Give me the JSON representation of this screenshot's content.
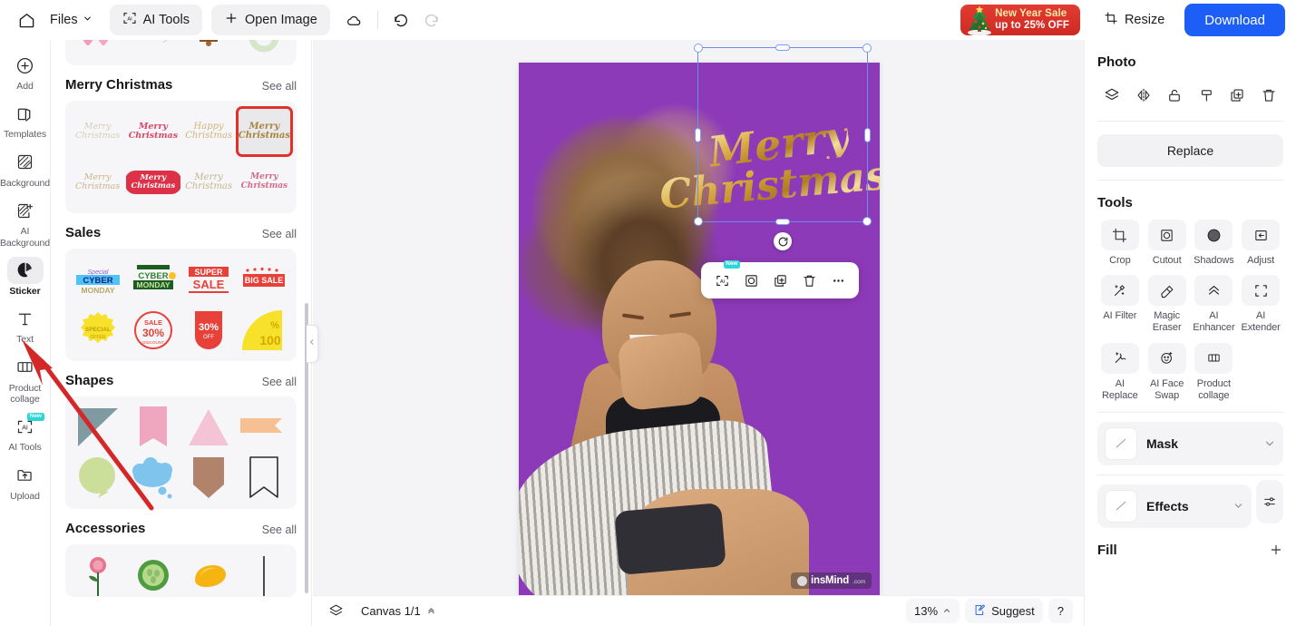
{
  "topbar": {
    "home_icon": "home-icon",
    "files_label": "Files",
    "files_chevron": "chevron-down-icon",
    "ai_tools_label": "AI Tools",
    "open_image_label": "Open Image",
    "cloud_icon": "cloud-sync-icon",
    "undo_icon": "undo-icon",
    "redo_icon": "redo-icon",
    "sale_line1": "New Year Sale",
    "sale_line2": "up to 25% OFF",
    "resize_label": "Resize",
    "download_label": "Download"
  },
  "rail": {
    "items": [
      {
        "label": "Add",
        "icon": "plus-circle-icon",
        "active": false
      },
      {
        "label": "Templates",
        "icon": "templates-icon",
        "active": false
      },
      {
        "label": "Background",
        "icon": "background-icon",
        "active": false
      },
      {
        "label": "AI Background",
        "icon": "ai-background-icon",
        "active": false
      },
      {
        "label": "Sticker",
        "icon": "sticker-icon",
        "active": true
      },
      {
        "label": "Text",
        "icon": "text-icon",
        "active": false
      },
      {
        "label": "Product collage",
        "icon": "product-collage-icon",
        "active": false
      },
      {
        "label": "AI Tools",
        "icon": "ai-tools-icon",
        "active": false,
        "badge": "New"
      },
      {
        "label": "Upload",
        "icon": "upload-icon",
        "active": false
      }
    ]
  },
  "panel": {
    "see_all_label": "See all",
    "sections": [
      {
        "title": "",
        "partial": true,
        "items": [
          {
            "kind": "xmas-hearts",
            "label": "pink hearts sticker"
          },
          {
            "kind": "xmas-text-faded",
            "label": "faded text sticker"
          },
          {
            "kind": "xmas-bells",
            "label": "christmas bells sticker"
          },
          {
            "kind": "xmas-wreath",
            "label": "green wreath sticker"
          }
        ]
      },
      {
        "title": "Merry Christmas",
        "items": [
          {
            "kind": "script-gold-pale",
            "label": "Merry Christmas pale gold script",
            "selected": false
          },
          {
            "kind": "script-red-dots",
            "label": "Merry Christmas red script",
            "selected": false
          },
          {
            "kind": "script-gold-light",
            "label": "Happy Christmas gold script",
            "selected": false
          },
          {
            "kind": "script-gold-bold",
            "label": "Merry Christmas gold script",
            "selected": true
          },
          {
            "kind": "script-gold-outline",
            "label": "Merry Christmas gold outline",
            "selected": false
          },
          {
            "kind": "script-red-badge",
            "label": "Merry Christmas red badge",
            "selected": false
          },
          {
            "kind": "script-cream-swirl",
            "label": "Merry Christmas cream swirl",
            "selected": false
          },
          {
            "kind": "script-pink-small",
            "label": "Merry Christmas pink script",
            "selected": false
          }
        ]
      },
      {
        "title": "Sales",
        "items": [
          {
            "kind": "cyber-monday-blue",
            "label": "Cyber Monday blue sticker",
            "text": "CYBER MONDAY"
          },
          {
            "kind": "cyber-monday-green",
            "label": "Cyber Monday green sticker",
            "text": "CYBER MONDAY"
          },
          {
            "kind": "super-sale",
            "label": "Super Sale sticker",
            "text": "SUPER SALE"
          },
          {
            "kind": "big-sale",
            "label": "Big Sale sticker",
            "text": "BIG SALE"
          },
          {
            "kind": "special-offer",
            "label": "Special Offer badge",
            "text": "SPECIAL OFFER"
          },
          {
            "kind": "sale-30-circle",
            "label": "Sale 30% discount circle",
            "text": "SALE 30% DISCOUNT"
          },
          {
            "kind": "30-off-tag",
            "label": "30% Off red tag",
            "text": "30% OFF"
          },
          {
            "kind": "100-percent",
            "label": "100 percent yellow badge",
            "text": "% 100"
          }
        ]
      },
      {
        "title": "Shapes",
        "items": [
          {
            "kind": "shape-triangle-grey",
            "label": "grey triangle block shape"
          },
          {
            "kind": "shape-banner-pink",
            "label": "pink ribbon banner shape"
          },
          {
            "kind": "shape-triangle-pink",
            "label": "pink triangle shape"
          },
          {
            "kind": "shape-flag-orange",
            "label": "orange flag shape"
          },
          {
            "kind": "shape-bubble-green",
            "label": "green speech bubble shape"
          },
          {
            "kind": "shape-cloud-blue",
            "label": "blue thought bubble shape"
          },
          {
            "kind": "shape-shield-brown",
            "label": "brown shield shape"
          },
          {
            "kind": "shape-bookmark-outline",
            "label": "outlined bookmark shape"
          }
        ]
      },
      {
        "title": "Accessories",
        "partial_bottom": true,
        "items": [
          {
            "kind": "acc-rose",
            "label": "pink rose sticker"
          },
          {
            "kind": "acc-cucumber",
            "label": "cucumber slice sticker"
          },
          {
            "kind": "acc-pepper",
            "label": "yellow pepper sticker"
          },
          {
            "kind": "acc-line",
            "label": "vertical line sticker"
          }
        ]
      }
    ],
    "collapse_icon": "chevron-left-icon"
  },
  "canvas": {
    "artboard": {
      "background_color": "#8d3ab9",
      "text_line1": "Merry",
      "text_line2": "Christmas",
      "watermark_name": "insMind",
      "watermark_suffix": ".com"
    },
    "selection": {
      "rotate_icon": "rotate-icon",
      "handles": [
        "top-left",
        "top-center",
        "top-right",
        "left-center",
        "right-center",
        "bottom-left",
        "bottom-center",
        "bottom-right"
      ]
    },
    "context_toolbar": [
      {
        "icon": "ai-tools-icon",
        "name": "ai-tools-button",
        "badge": "New"
      },
      {
        "icon": "cutout-icon",
        "name": "cutout-button"
      },
      {
        "icon": "duplicate-icon",
        "name": "duplicate-button"
      },
      {
        "icon": "trash-icon",
        "name": "delete-button"
      },
      {
        "icon": "more-icon",
        "name": "more-options-button"
      }
    ]
  },
  "bottombar": {
    "layers_icon": "layers-icon",
    "canvas_label": "Canvas 1/1",
    "canvas_chevron": "chevron-up-double-icon",
    "zoom_label": "13%",
    "zoom_chevron": "chevron-up-icon",
    "suggest_label": "Suggest",
    "suggest_icon": "suggest-icon",
    "help_label": "?"
  },
  "right": {
    "photo_title": "Photo",
    "photo_icons": [
      {
        "icon": "layers-icon",
        "name": "layer-order-button"
      },
      {
        "icon": "flip-icon",
        "name": "flip-button"
      },
      {
        "icon": "lock-icon",
        "name": "lock-button"
      },
      {
        "icon": "eyedropper-icon",
        "name": "color-picker-button"
      },
      {
        "icon": "duplicate-icon",
        "name": "duplicate-button"
      },
      {
        "icon": "trash-icon",
        "name": "delete-button"
      }
    ],
    "replace_label": "Replace",
    "tools_title": "Tools",
    "tools": [
      {
        "label": "Crop",
        "icon": "crop-icon"
      },
      {
        "label": "Cutout",
        "icon": "cutout-icon"
      },
      {
        "label": "Shadows",
        "icon": "shadows-icon"
      },
      {
        "label": "Adjust",
        "icon": "adjust-icon"
      },
      {
        "label": "AI Filter",
        "icon": "ai-filter-icon"
      },
      {
        "label": "Magic Eraser",
        "icon": "magic-eraser-icon"
      },
      {
        "label": "AI Enhancer",
        "icon": "ai-enhancer-icon"
      },
      {
        "label": "AI Extender",
        "icon": "ai-extender-icon"
      },
      {
        "label": "AI Replace",
        "icon": "ai-replace-icon"
      },
      {
        "label": "AI Face Swap",
        "icon": "ai-face-swap-icon"
      },
      {
        "label": "Product collage",
        "icon": "product-collage-icon"
      }
    ],
    "mask_label": "Mask",
    "effects_label": "Effects",
    "effects_settings_icon": "sliders-icon",
    "fill_label": "Fill",
    "fill_add_icon": "plus-icon"
  },
  "annotation": {
    "arrow_color": "#d42828",
    "arrow_from": "sticker-rail-item",
    "arrow_to": "shapes-cloud-sticker"
  },
  "colors": {
    "accent_blue": "#1d5ff6",
    "sale_red": "#d42d24",
    "artboard_purple": "#8d3ab9",
    "selection_blue": "#6b8cf0",
    "badge_cyan": "#2ad6d6"
  }
}
